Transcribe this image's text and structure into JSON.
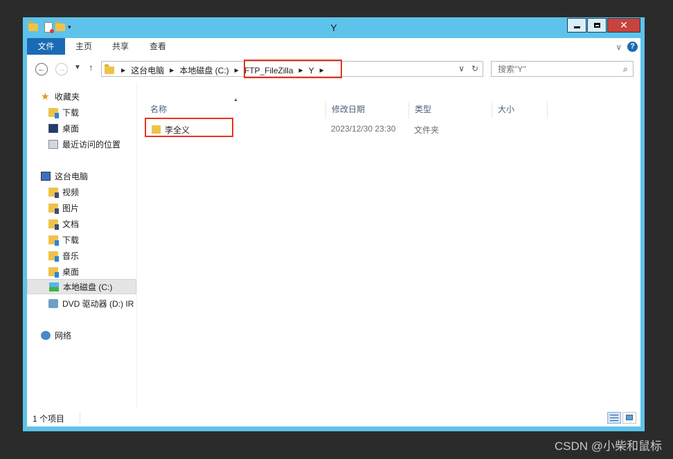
{
  "window": {
    "title": "Y"
  },
  "ribbon": {
    "tabs": [
      "文件",
      "主页",
      "共享",
      "查看"
    ]
  },
  "address": {
    "crumbs": [
      "这台电脑",
      "本地磁盘 (C:)",
      "FTP_FileZilla",
      "Y"
    ]
  },
  "search": {
    "placeholder": "搜索\"Y\""
  },
  "sidebar": {
    "favorites_label": "收藏夹",
    "favorites": [
      "下载",
      "桌面",
      "最近访问的位置"
    ],
    "computer_label": "这台电脑",
    "computer": [
      "视频",
      "图片",
      "文档",
      "下载",
      "音乐",
      "桌面",
      "本地磁盘 (C:)",
      "DVD 驱动器 (D:) IR"
    ],
    "network_label": "网络"
  },
  "columns": [
    "名称",
    "修改日期",
    "类型",
    "大小"
  ],
  "files": [
    {
      "name": "李全义",
      "date": "2023/12/30 23:30",
      "type": "文件夹",
      "size": ""
    }
  ],
  "status": {
    "item_count": "1 个项目"
  },
  "watermark": "CSDN @小柴和鼠标",
  "colors": {
    "titlebar": "#5ec3ea",
    "file_tab": "#1a6bb5",
    "highlight": "#e8331f"
  }
}
